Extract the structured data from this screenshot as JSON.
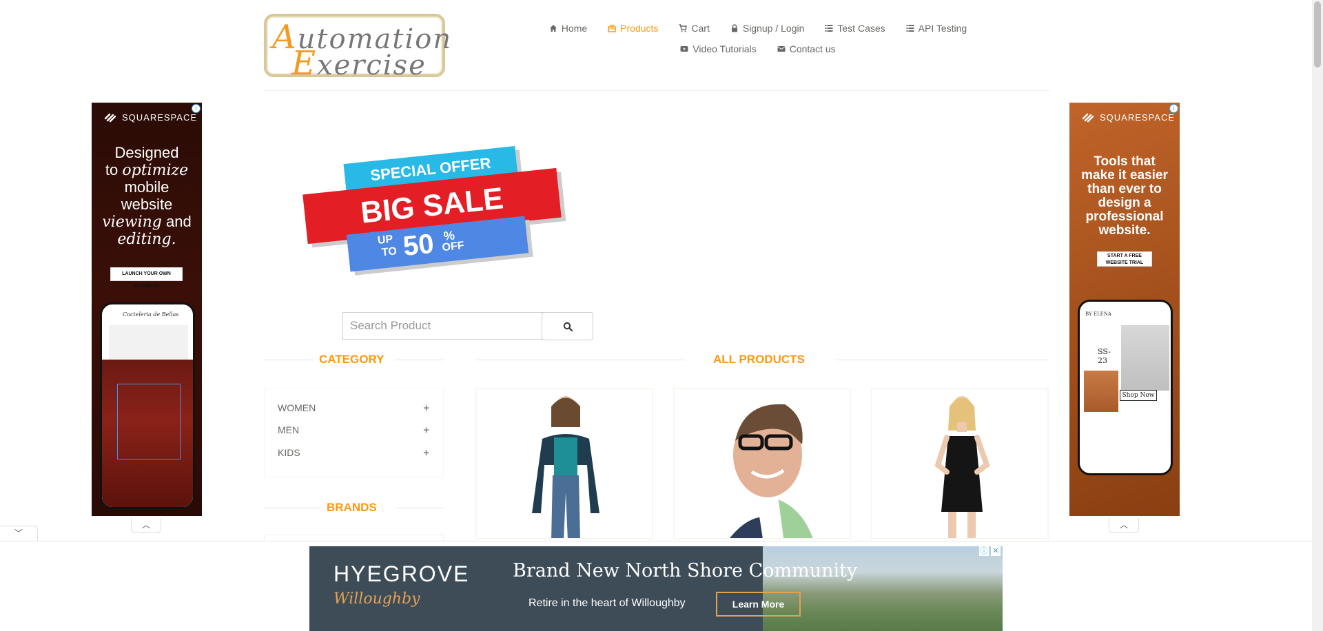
{
  "logo": {
    "line1_cap": "A",
    "line1_rest": "utomation",
    "line2_cap": "E",
    "line2_rest": "xercise"
  },
  "nav": {
    "row1": [
      {
        "label": "Home",
        "icon": "home-icon",
        "active": false
      },
      {
        "label": "Products",
        "icon": "products-icon",
        "active": true
      },
      {
        "label": "Cart",
        "icon": "cart-icon",
        "active": false
      },
      {
        "label": "Signup / Login",
        "icon": "lock-icon",
        "active": false
      },
      {
        "label": "Test Cases",
        "icon": "list-icon",
        "active": false
      },
      {
        "label": "API Testing",
        "icon": "list-icon",
        "active": false
      }
    ],
    "row2": [
      {
        "label": "Video Tutorials",
        "icon": "youtube-icon",
        "active": false
      },
      {
        "label": "Contact us",
        "icon": "envelope-icon",
        "active": false
      }
    ]
  },
  "left_ad": {
    "brand": "SQUARESPACE",
    "line1": "Designed",
    "line2a": "to ",
    "line2b": "optimize",
    "line3": "mobile",
    "line4": "website",
    "line5a": "viewing",
    "line5b": " and",
    "line6": "editing.",
    "cta": "LAUNCH YOUR OWN BUSINESS",
    "phone_title": "Cocteleria de Bellas"
  },
  "right_ad": {
    "brand": "SQUARESPACE",
    "headline": [
      "Tools that",
      "make it easier",
      "than ever to",
      "design a",
      "professional",
      "website."
    ],
    "cta": "START A FREE WEBSITE TRIAL",
    "phone_title": "BY ELENA",
    "phone_code": "SS-23",
    "phone_btn": "Shop Now"
  },
  "sale_banner": {
    "special": "SPECIAL OFFER",
    "big": "BIG SALE",
    "up": "UP",
    "to": "TO",
    "pct": "50",
    "pct_sign": "%",
    "off": "OFF"
  },
  "search": {
    "placeholder": "Search Product"
  },
  "sidebar": {
    "category_title": "CATEGORY",
    "categories": [
      "WOMEN",
      "MEN",
      "KIDS"
    ],
    "brands_title": "BRANDS"
  },
  "main": {
    "title": "ALL PRODUCTS"
  },
  "bottom_ad": {
    "brand": "HYEGROVE",
    "sub": "Willoughby",
    "headline": "Brand New North Shore Community",
    "tagline": "Retire in the heart of Willoughby",
    "cta": "Learn More"
  },
  "colors": {
    "accent": "#fe980f",
    "text": "#696763"
  }
}
